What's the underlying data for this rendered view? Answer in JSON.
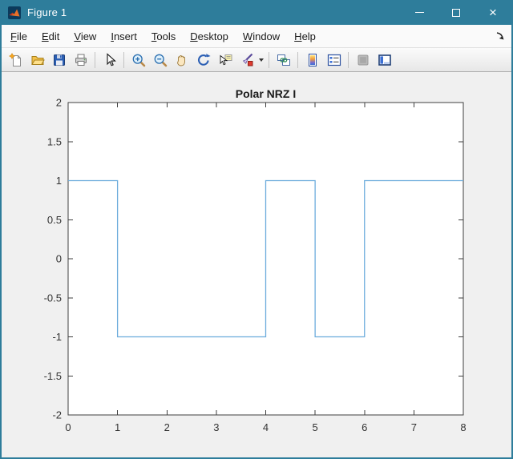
{
  "titlebar": {
    "title": "Figure 1",
    "close_glyph": "×"
  },
  "menubar": {
    "items": [
      "File",
      "Edit",
      "View",
      "Insert",
      "Tools",
      "Desktop",
      "Window",
      "Help"
    ]
  },
  "toolbar": {
    "icons": [
      "new-file",
      "open-file",
      "save-figure",
      "print-figure",
      "edit-plot-pointer",
      "zoom-in",
      "zoom-out",
      "pan",
      "rotate-3d",
      "data-cursor",
      "brush-data",
      "link-plot",
      "insert-colorbar",
      "insert-legend",
      "hide-plot-tools",
      "show-plot-tools-dock"
    ]
  },
  "chart_data": {
    "type": "line",
    "title": "Polar NRZ I",
    "x": [
      0,
      1,
      1,
      4,
      4,
      5,
      5,
      6,
      6,
      8
    ],
    "y": [
      1,
      1,
      -1,
      -1,
      1,
      1,
      -1,
      -1,
      1,
      1
    ],
    "xlim": [
      0,
      8
    ],
    "ylim": [
      -2,
      2
    ],
    "xticks": [
      0,
      1,
      2,
      3,
      4,
      5,
      6,
      7,
      8
    ],
    "yticks": [
      -2,
      -1.5,
      -1,
      -0.5,
      0,
      0.5,
      1,
      1.5,
      2
    ],
    "xlabel": "",
    "ylabel": "",
    "grid": false,
    "line_color": "#6CACDC",
    "line_width": 1.3
  },
  "colors": {
    "titlebar": "#2E7D9B",
    "figure_background": "#F0F0F0",
    "plot_background": "#FFFFFF",
    "axis_color": "#3F3F3F",
    "line_color": "#6CACDC"
  }
}
